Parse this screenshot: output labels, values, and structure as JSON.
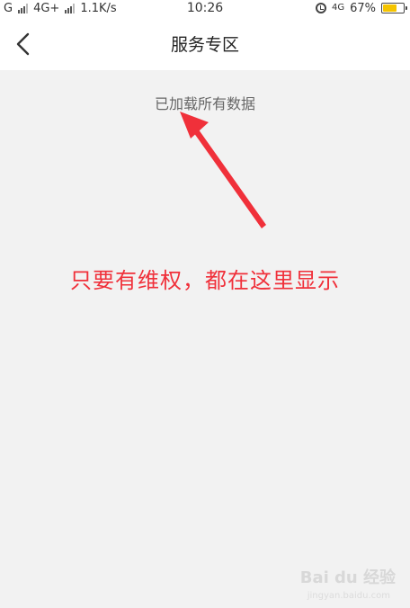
{
  "status_bar": {
    "sim1_label": "G",
    "sim2_label": "4G+",
    "speed": "1.1K/s",
    "time": "10:26",
    "network_right": "4G",
    "battery_percent": "67%",
    "battery_level": 0.67
  },
  "header": {
    "title": "服务专区"
  },
  "content": {
    "loaded_message": "已加载所有数据",
    "annotation": "只要有维权，都在这里显示"
  },
  "watermark": {
    "text": "Bai du 经验",
    "sub": "jingyan.baidu.com"
  },
  "colors": {
    "annotation": "#f0303a",
    "background": "#f2f2f2",
    "battery": "#f5c400"
  }
}
